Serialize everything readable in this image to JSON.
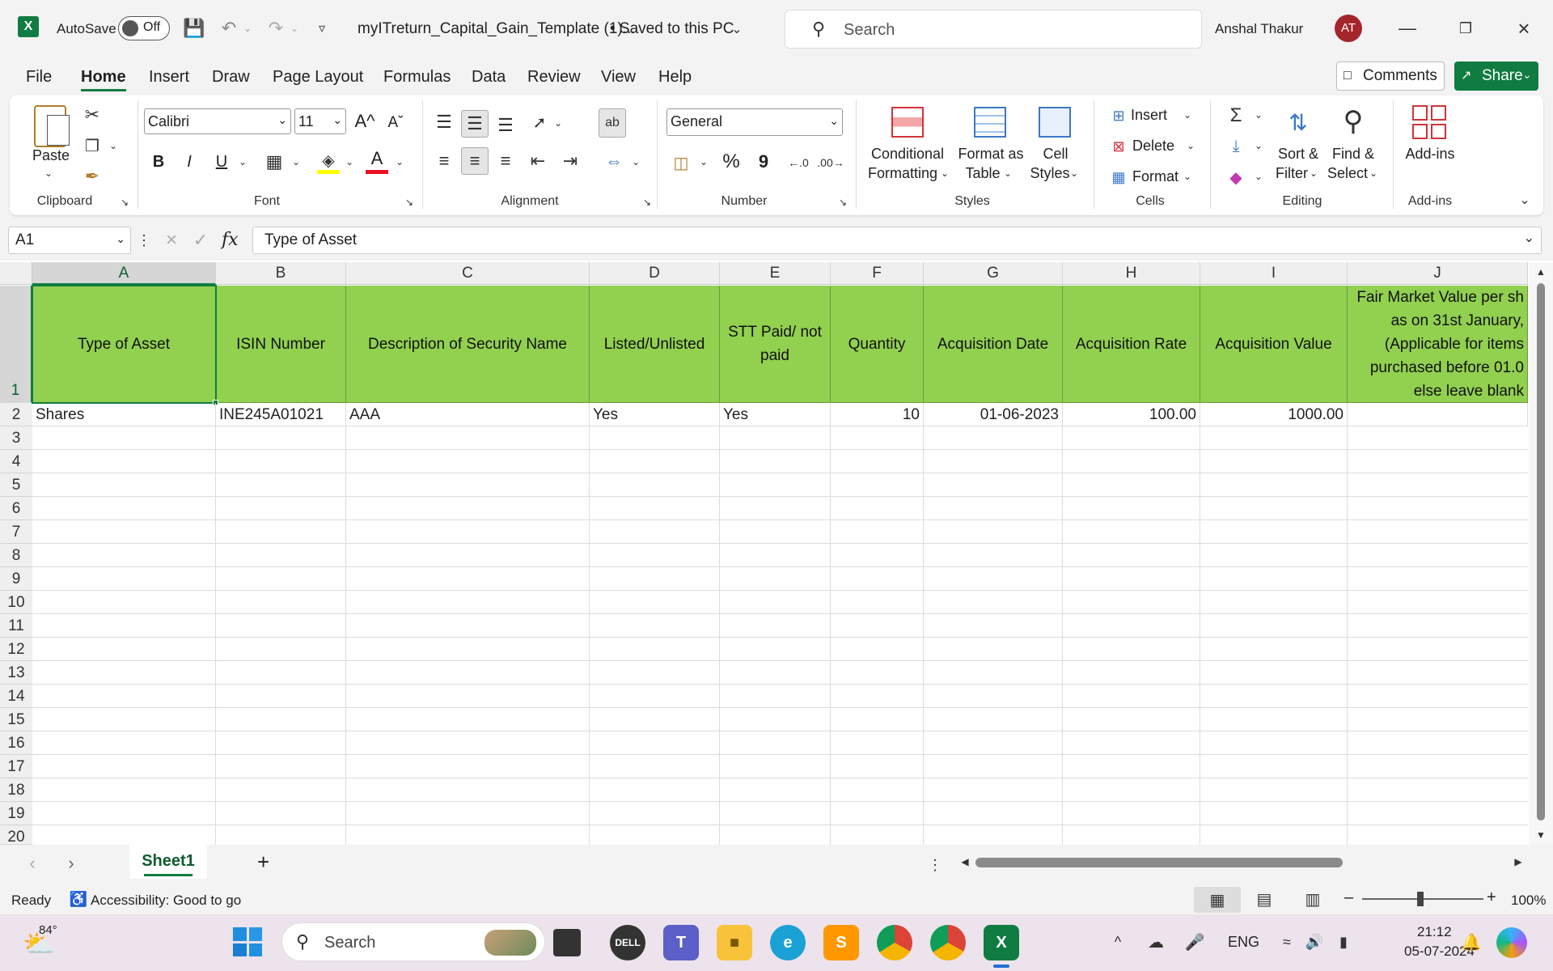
{
  "titlebar": {
    "autosave_label": "AutoSave",
    "autosave_state": "Off",
    "file_name": "myITreturn_Capital_Gain_Template (1)...",
    "save_status": "• Saved to this PC",
    "search_placeholder": "Search",
    "user_name": "Anshal Thakur",
    "user_initials": "AT"
  },
  "menu": {
    "tabs": [
      "File",
      "Home",
      "Insert",
      "Draw",
      "Page Layout",
      "Formulas",
      "Data",
      "Review",
      "View",
      "Help"
    ],
    "active_tab": "Home",
    "comments_label": "Comments",
    "share_label": "Share"
  },
  "ribbon": {
    "clipboard": {
      "paste": "Paste",
      "label": "Clipboard"
    },
    "font": {
      "name": "Calibri",
      "size": "11",
      "label": "Font",
      "bold": "B",
      "italic": "I",
      "underline": "U",
      "grow": "A^",
      "shrink": "Aˇ",
      "color_a": "A"
    },
    "alignment": {
      "label": "Alignment"
    },
    "number": {
      "format": "General",
      "label": "Number",
      "percent": "%",
      "comma": "9"
    },
    "styles": {
      "conditional": "Conditional",
      "conditional2": "Formatting",
      "format_table": "Format as",
      "format_table2": "Table",
      "cell_styles": "Cell",
      "cell_styles2": "Styles",
      "label": "Styles"
    },
    "cells": {
      "insert": "Insert",
      "delete": "Delete",
      "format": "Format",
      "label": "Cells"
    },
    "editing": {
      "sort": "Sort &",
      "sort2": "Filter",
      "find": "Find &",
      "find2": "Select",
      "label": "Editing"
    },
    "addins": {
      "addins": "Add-ins",
      "label": "Add-ins"
    }
  },
  "formula_bar": {
    "name_box": "A1",
    "fx": "fx",
    "content": "Type of Asset"
  },
  "sheet": {
    "columns": [
      "A",
      "B",
      "C",
      "D",
      "E",
      "F",
      "G",
      "H",
      "I",
      "J"
    ],
    "rows": [
      "1",
      "2",
      "3",
      "4",
      "5",
      "6",
      "7",
      "8",
      "9",
      "10",
      "11",
      "12",
      "13",
      "14",
      "15",
      "16",
      "17",
      "18",
      "19",
      "20"
    ],
    "headers": {
      "a": "Type of Asset",
      "b": "ISIN Number",
      "c": "Description of Security Name",
      "d": "Listed/Unlisted",
      "e": "STT Paid/ not paid",
      "f": "Quantity",
      "g": "Acquisition Date",
      "h": "Acquisition Rate",
      "i": "Acquisition Value",
      "j": "Fair Market Value per sh as on 31st January, (Applicable for items purchased before 01.0 else leave blank"
    },
    "row2": {
      "a": "Shares",
      "b": "INE245A01021",
      "c": "AAA",
      "d": "Yes",
      "e": "Yes",
      "f": "10",
      "g": "01-06-2023",
      "h": "100.00",
      "i": "1000.00"
    },
    "header_color": "#92d050"
  },
  "sheetbar": {
    "active_sheet": "Sheet1",
    "add": "+"
  },
  "status": {
    "ready": "Ready",
    "accessibility": "Accessibility: Good to go",
    "zoom": "100%"
  },
  "taskbar": {
    "weather": "84°",
    "search_placeholder": "Search",
    "lang": "ENG",
    "time": "21:12",
    "date": "05-07-2024"
  }
}
